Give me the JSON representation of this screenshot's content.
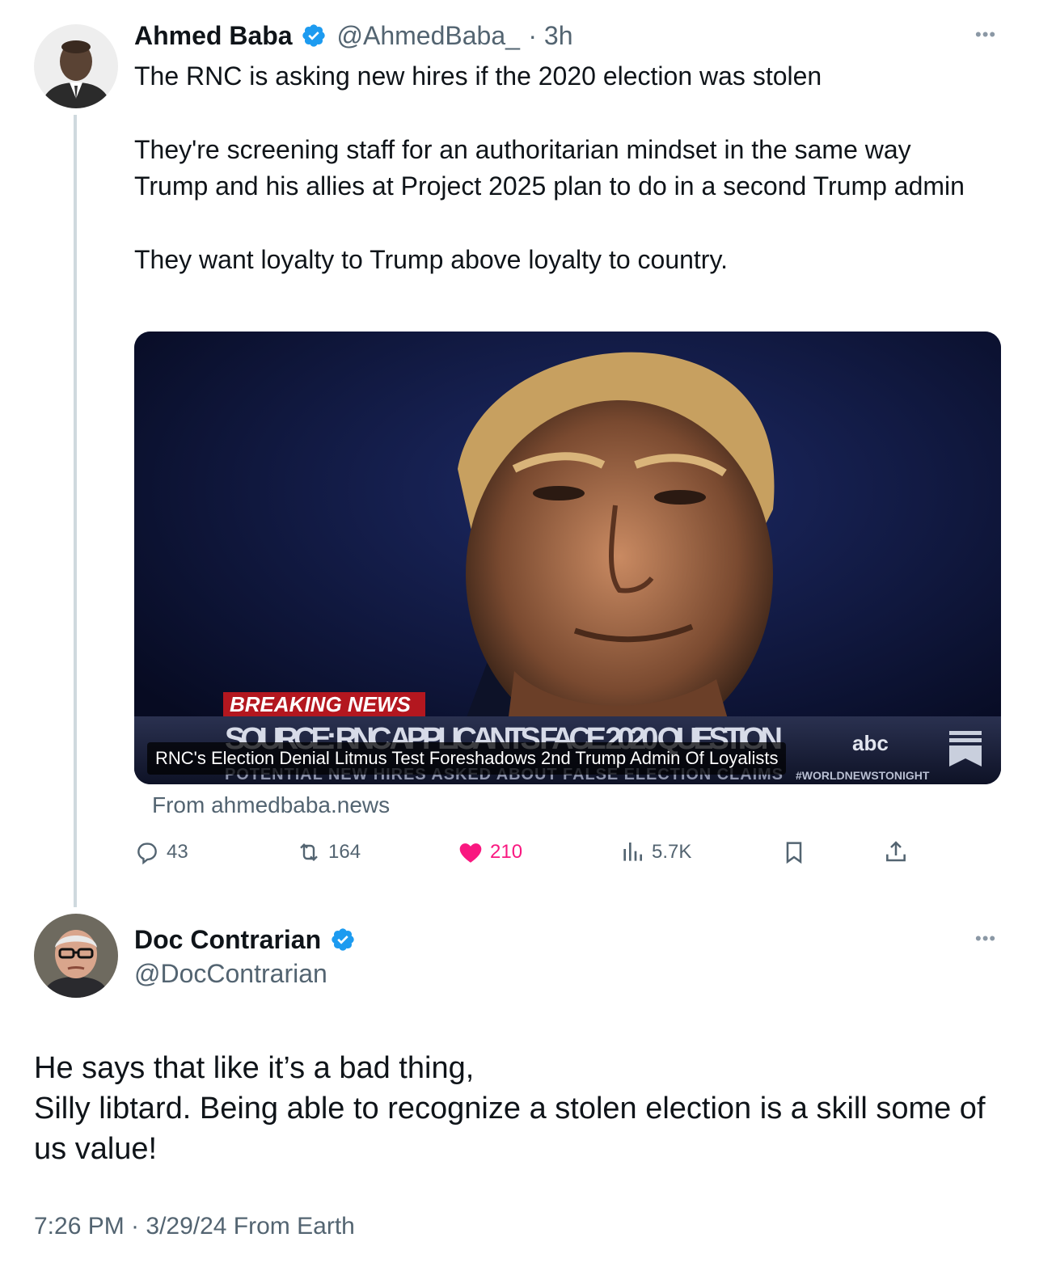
{
  "original_tweet": {
    "author_name": "Ahmed Baba",
    "handle": "@AhmedBaba_",
    "time": "· 3h",
    "paragraphs": [
      "The RNC is asking new hires if the 2020 election was stolen",
      "They're screening staff for an authoritarian mindset in the same way Trump and his allies at Project 2025 plan to do in a second Trump admin",
      "They want loyalty to Trump above loyalty to country."
    ],
    "link_card": {
      "headline": "RNC's Election Denial Litmus Test Foreshadows 2nd Trump Admin Of Loyalists",
      "source": "From ahmedbaba.news",
      "image_text": {
        "breaking": "BREAKING NEWS",
        "chyron": "SOURCE: RNC APPLICANTS FACE 2020 QUESTION",
        "subchyron": "POTENTIAL NEW HIRES ASKED ABOUT FALSE ELECTION CLAIMS",
        "network": "abc",
        "hashtag": "#WORLDNEWSTONIGHT"
      }
    },
    "actions": {
      "replies": "43",
      "reposts": "164",
      "likes": "210",
      "views": "5.7K"
    },
    "icons": [
      "more-icon",
      "verified-badge-icon",
      "reply-icon",
      "repost-icon",
      "like-icon",
      "views-icon",
      "bookmark-icon",
      "share-icon"
    ]
  },
  "reply_tweet": {
    "author_name": "Doc Contrarian",
    "handle": "@DocContrarian",
    "lines": [
      "He says that like it’s a bad thing,",
      "Silly libtard. Being able to recognize a stolen election is a skill some of us value!"
    ],
    "meta": "7:26 PM · 3/29/24 From Earth"
  },
  "colors": {
    "verified": "#1d9bf0",
    "like": "#f91880",
    "secondary_text": "#536471",
    "thread_line": "#cfd9de"
  }
}
